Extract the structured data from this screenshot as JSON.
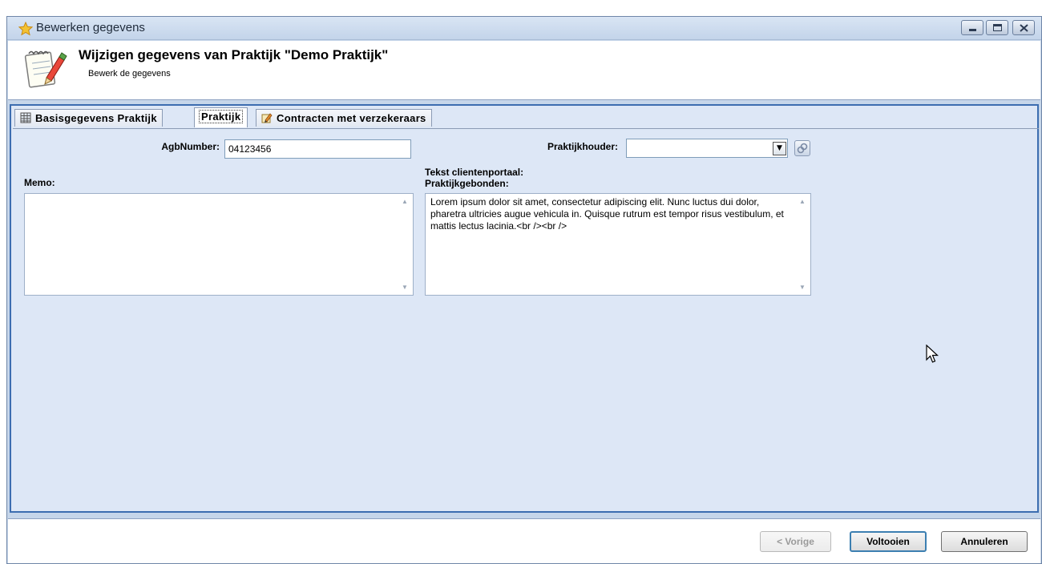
{
  "window": {
    "title": "Bewerken gegevens",
    "controls": [
      "minimize",
      "maximize",
      "close"
    ]
  },
  "header": {
    "title": "Wijzigen gegevens van Praktijk \"Demo Praktijk\"",
    "subtitle": "Bewerk de gegevens",
    "icon": "notepad-pencil-icon"
  },
  "tabs": [
    {
      "label": "Basisgegevens Praktijk",
      "icon": "table-icon",
      "active": false
    },
    {
      "label": "Praktijk",
      "active": true
    },
    {
      "label": "Contracten met verzekeraars",
      "icon": "contract-pencil-icon",
      "active": false
    }
  ],
  "form": {
    "agb_label": "AgbNumber:",
    "agb_value": "04123456",
    "praktijkhouder_label": "Praktijkhouder:",
    "praktijkhouder_value": "",
    "memo_label": "Memo:",
    "memo_value": "",
    "portal_label_line1": "Tekst clientenportaal:",
    "portal_label_line2": "Praktijkgebonden:",
    "portal_value": "Lorem ipsum dolor sit amet, consectetur adipiscing elit. Nunc luctus dui dolor, pharetra ultricies augue vehicula in. Quisque rutrum est tempor risus vestibulum, et mattis lectus lacinia.<br /><br />"
  },
  "footer": {
    "prev_label": "< Vorige",
    "finish_label": "Voltooien",
    "cancel_label": "Annuleren"
  },
  "colors": {
    "titlebar": "#c3d4ea",
    "tab_border": "#3c6db0",
    "panel_bg": "#dde7f6"
  }
}
